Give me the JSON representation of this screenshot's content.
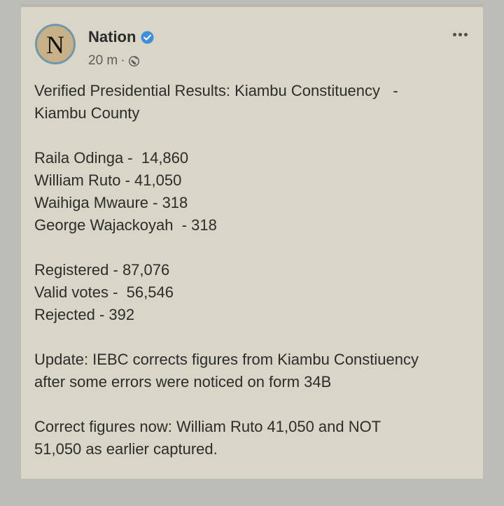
{
  "post": {
    "page_name": "Nation",
    "avatar_letter": "N",
    "time": "20 m",
    "separator": "·",
    "lines": [
      "Verified Presidential Results: Kiambu Constituency   -",
      "Kiambu County",
      "",
      "Raila Odinga -  14,860",
      "William Ruto - 41,050",
      "Waihiga Mwaure - 318",
      "George Wajackoyah  - 318",
      "",
      "Registered - 87,076",
      "Valid votes -  56,546",
      "Rejected - 392",
      "",
      "Update: IEBC corrects figures from Kiambu Constiuency",
      "after some errors were noticed on form 34B",
      "",
      "Correct figures now: William Ruto 41,050 and NOT",
      "51,050 as earlier captured."
    ]
  },
  "colors": {
    "background": "#bdbdb8",
    "card": "#d9d6c8",
    "verified": "#3f8fd8",
    "avatar_fill": "#c8b089",
    "avatar_ring": "#6f98aa"
  },
  "icons": {
    "verified": "verified-badge-icon",
    "audience": "globe-icon",
    "menu": "more-options-icon"
  }
}
